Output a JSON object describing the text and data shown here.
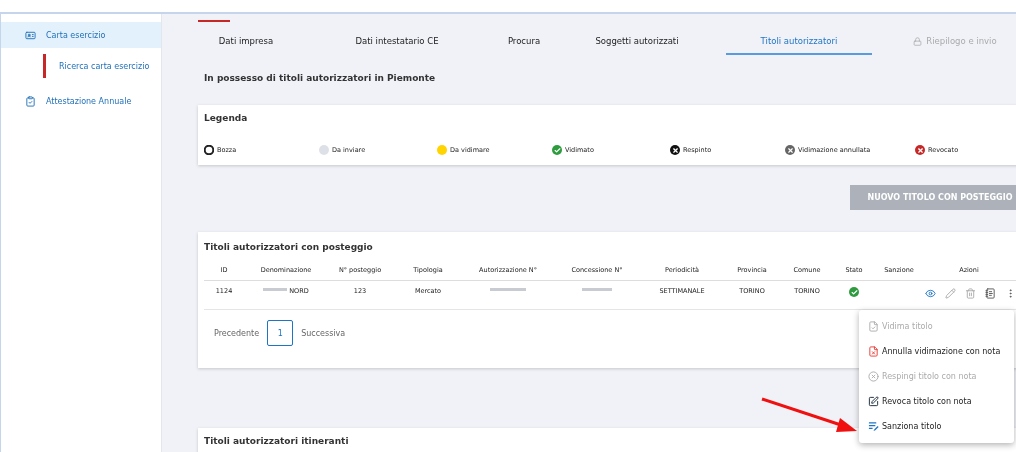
{
  "sidebar": {
    "items": [
      {
        "label": "Carta esercizio",
        "kind": "card",
        "selected": true,
        "children": [
          {
            "label": "Ricerca carta esercizio",
            "selected": true
          }
        ]
      },
      {
        "label": "Attestazione Annuale",
        "kind": "form",
        "selected": false
      }
    ]
  },
  "tabs": [
    {
      "label": "Dati impresa",
      "selected": false,
      "locked": false
    },
    {
      "label": "Dati intestatario CE",
      "selected": false,
      "locked": false
    },
    {
      "label": "Procura",
      "selected": false,
      "locked": false
    },
    {
      "label": "Soggetti autorizzati",
      "selected": false,
      "locked": false
    },
    {
      "label": "Titoli autorizzatori",
      "selected": true,
      "locked": false
    },
    {
      "label": "Riepilogo e invio",
      "selected": false,
      "locked": true
    }
  ],
  "subtitle": "In possesso di titoli autorizzatori in Piemonte",
  "legend": {
    "title": "Legenda",
    "items": [
      {
        "label": "Bozza",
        "kind": "outline",
        "color": "#222222"
      },
      {
        "label": "Da inviare",
        "kind": "dot",
        "color": "#dde1e7"
      },
      {
        "label": "Da vidimare",
        "kind": "dot",
        "color": "#ffd400"
      },
      {
        "label": "Vidimato",
        "kind": "check",
        "color": "#2e9b3f"
      },
      {
        "label": "Respinto",
        "kind": "cross",
        "color": "#111111"
      },
      {
        "label": "Vidimazione annullata",
        "kind": "cross",
        "color": "#666666"
      },
      {
        "label": "Revocato",
        "kind": "cross",
        "color": "#c62828"
      }
    ]
  },
  "new_button": {
    "label": "NUOVO TITOLO CON POSTEGGIO",
    "disabled": true
  },
  "table": {
    "title": "Titoli autorizzatori con posteggio",
    "columns": [
      "ID",
      "Denominazione",
      "N° posteggio",
      "Tipologia",
      "Autorizzazione N°",
      "Concessione N°",
      "Periodicità",
      "Provincia",
      "Comune",
      "Stato",
      "Sanzione",
      "Azioni"
    ],
    "rows": [
      {
        "cells": [
          {
            "text": "1124",
            "redacted": false
          },
          {
            "text": "NORD",
            "redacted": true
          },
          {
            "text": "123",
            "redacted": false
          },
          {
            "text": "Mercato",
            "redacted": false
          },
          {
            "text": "",
            "redacted": true
          },
          {
            "text": "",
            "redacted": true
          },
          {
            "text": "SETTIMANALE",
            "redacted": false
          },
          {
            "text": "TORINO",
            "redacted": false
          },
          {
            "text": "TORINO",
            "redacted": false
          }
        ],
        "status": {
          "kind": "check"
        },
        "actions": [
          {
            "kind": "view",
            "disabled": false
          },
          {
            "kind": "edit",
            "disabled": true
          },
          {
            "kind": "delete",
            "disabled": true
          },
          {
            "kind": "note",
            "disabled": false
          },
          {
            "kind": "more",
            "disabled": false
          }
        ]
      }
    ],
    "pagination": {
      "previous": "Precedente",
      "pages": [
        {
          "label": "1",
          "selected": true
        }
      ],
      "next": "Successiva"
    }
  },
  "menu": {
    "items": [
      {
        "label": "Vidima titolo",
        "kind": "validate",
        "disabled": true
      },
      {
        "label": "Annulla vidimazione con nota",
        "kind": "cancel",
        "disabled": false
      },
      {
        "label": "Respingi titolo con nota",
        "kind": "reject",
        "disabled": true
      },
      {
        "label": "Revoca titolo con nota",
        "kind": "revoke",
        "disabled": false
      },
      {
        "label": "Sanziona titolo",
        "kind": "sanction",
        "disabled": false
      }
    ]
  },
  "second_table": {
    "title": "Titoli autorizzatori itineranti"
  }
}
